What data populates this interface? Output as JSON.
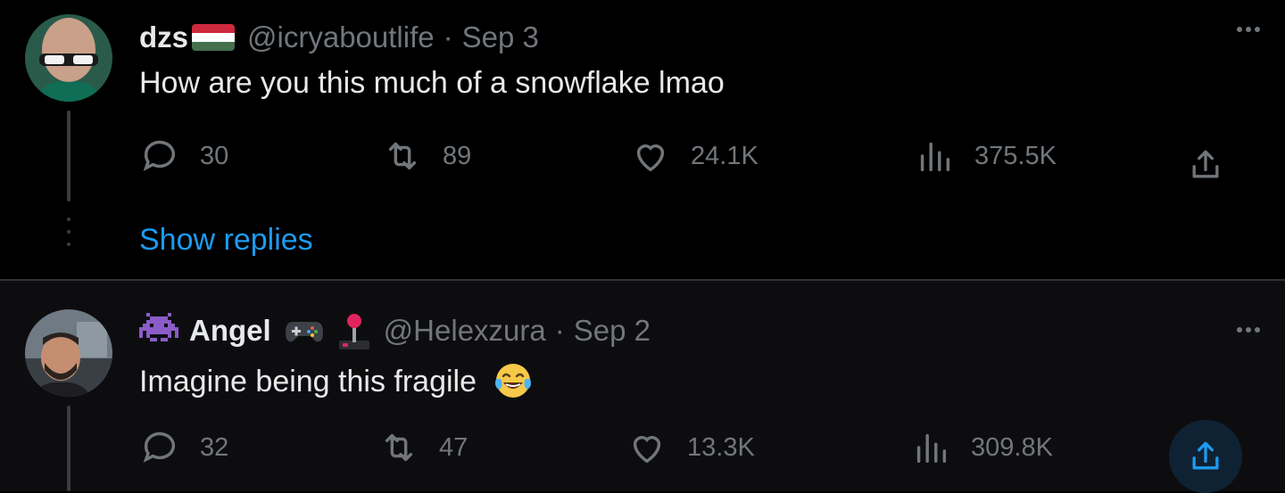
{
  "tweets": [
    {
      "name": "dzs",
      "name_emoji": "hungary-flag",
      "handle": "@icryaboutlife",
      "separator": "·",
      "date": "Sep 3",
      "text": "How are you this much of a snowflake lmao",
      "replies": "30",
      "retweets": "89",
      "likes": "24.1K",
      "views": "375.5K",
      "show_replies": "Show replies"
    },
    {
      "name": "Angel",
      "name_emojis": [
        "alien-monster",
        "game-controller",
        "joystick"
      ],
      "handle": "@Helexzura",
      "separator": "·",
      "date": "Sep 2",
      "text": "Imagine being this fragile",
      "text_emoji": "tears-of-joy",
      "replies": "32",
      "retweets": "47",
      "likes": "13.3K",
      "views": "309.8K"
    }
  ],
  "colors": {
    "background": "#000000",
    "text": "#e7e9ea",
    "muted": "#71767b",
    "link": "#1d9bf0",
    "divider": "#2f3336"
  }
}
